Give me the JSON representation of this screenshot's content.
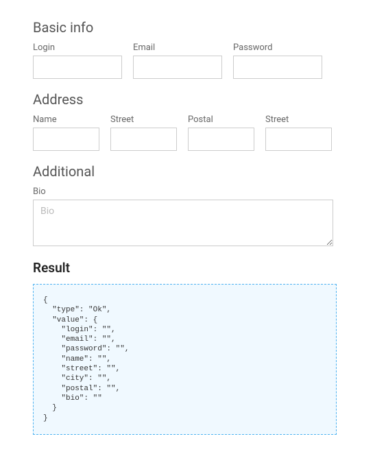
{
  "basic": {
    "heading": "Basic info",
    "login": {
      "label": "Login",
      "value": ""
    },
    "email": {
      "label": "Email",
      "value": ""
    },
    "password": {
      "label": "Password",
      "value": ""
    }
  },
  "address": {
    "heading": "Address",
    "name": {
      "label": "Name",
      "value": ""
    },
    "street": {
      "label": "Street",
      "value": ""
    },
    "postal": {
      "label": "Postal",
      "value": ""
    },
    "street2": {
      "label": "Street",
      "value": ""
    }
  },
  "additional": {
    "heading": "Additional",
    "bio": {
      "label": "Bio",
      "placeholder": "Bio",
      "value": ""
    }
  },
  "result": {
    "heading": "Result",
    "json_text": "{\n  \"type\": \"Ok\",\n  \"value\": {\n    \"login\": \"\",\n    \"email\": \"\",\n    \"password\": \"\",\n    \"name\": \"\",\n    \"street\": \"\",\n    \"city\": \"\",\n    \"postal\": \"\",\n    \"bio\": \"\"\n  }\n}"
  }
}
